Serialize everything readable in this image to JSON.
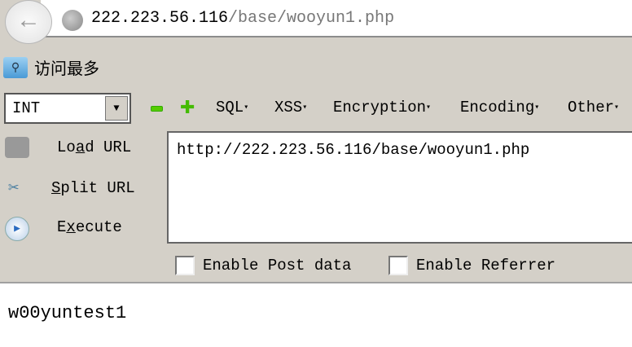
{
  "address_bar": {
    "host": "222.223.56.116",
    "path": "/base/wooyun1.php"
  },
  "bookmarks": {
    "label": "访问最多"
  },
  "toolbar": {
    "select_value": "INT",
    "menus": [
      "SQL",
      "XSS",
      "Encryption",
      "Encoding",
      "Other"
    ]
  },
  "side": {
    "load": [
      "Lo",
      "a",
      "d URL"
    ],
    "split": [
      "",
      "S",
      "plit URL"
    ],
    "execute": [
      "E",
      "x",
      "ecute"
    ]
  },
  "url_text": "http://222.223.56.116/base/wooyun1.php",
  "checkboxes": {
    "post": "Enable Post data",
    "referrer": "Enable Referrer"
  },
  "page_output": "w00yuntest1"
}
